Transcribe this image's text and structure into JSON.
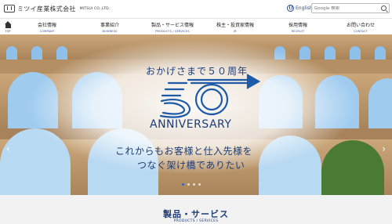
{
  "header": {
    "logo_jp": "ミツイ産業株式会社",
    "logo_en": "MITSUI CO.,LTD.",
    "lang_label": "English",
    "search_placeholder": "Google 検索"
  },
  "nav": {
    "home_label": "TOP",
    "items": [
      {
        "jp": "会社情報",
        "en": "COMPANY"
      },
      {
        "jp": "事業紹介",
        "en": "BUSINESS"
      },
      {
        "jp": "製品・サービス情報",
        "en": "PRODUCTS / SERVICES"
      },
      {
        "jp": "株主・投資家情報",
        "en": "IR"
      },
      {
        "jp": "採用情報",
        "en": "RECRUIT"
      },
      {
        "jp": "お問い合わせ",
        "en": "CONTACT"
      }
    ]
  },
  "hero": {
    "tagline": "おかげさまで５０周年",
    "anniversary": "ANNIVERSARY",
    "message_line1": "これからもお客様と仕入先様を",
    "message_line2": "つなぐ架け橋でありたい",
    "slide_count": 4,
    "active_slide": 1
  },
  "section": {
    "title": "製品・サービス",
    "subtitle": "PRODUCTS / SERVICES"
  }
}
